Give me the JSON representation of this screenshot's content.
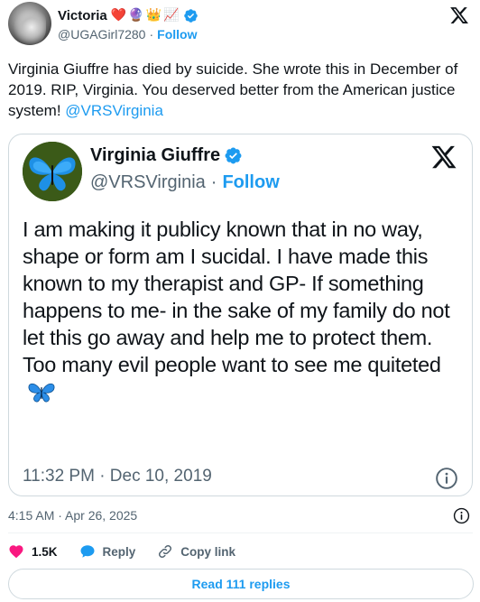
{
  "author": {
    "display_name": "Victoria",
    "name_emojis": [
      "❤️",
      "🔮",
      "👑",
      "📈"
    ],
    "handle": "@UGAGirl7280",
    "separator": "·",
    "follow_label": "Follow",
    "verified": true
  },
  "tweet": {
    "text_before_mention": "Virginia Giuffre has died by suicide. She wrote this in December of 2019. RIP, Virginia.  You deserved better from the American justice system! ",
    "mention": "@VRSVirginia",
    "timestamp": "4:15 AM · Apr 26, 2025"
  },
  "quoted_post": {
    "display_name": "Virginia Giuffre",
    "handle": "@VRSVirginia",
    "separator": "·",
    "follow_label": "Follow",
    "verified": true,
    "text": "I am making it publicy known that in no way, shape or form am I sucidal. I have made this known to my therapist and GP- If something happens to me- in the sake of my family do not let this go away and help me to protect them. Too many evil people want to see me quiteted",
    "trailing_emoji": "butterfly-emoji",
    "timestamp": "11:32 PM · Dec 10, 2019"
  },
  "actions": {
    "likes_count": "1.5K",
    "reply_label": "Reply",
    "copy_link_label": "Copy link"
  },
  "read_replies_label": "Read 111 replies",
  "icons": {
    "x_logo": "x-logo-icon",
    "verified": "verified-badge-icon",
    "heart": "heart-icon",
    "reply": "reply-bubble-icon",
    "link": "link-icon",
    "info": "info-icon"
  },
  "colors": {
    "accent": "#1d9bf0",
    "text_primary": "#0f1419",
    "text_secondary": "#536471",
    "heart": "#f91880",
    "border": "#cfd9de"
  }
}
